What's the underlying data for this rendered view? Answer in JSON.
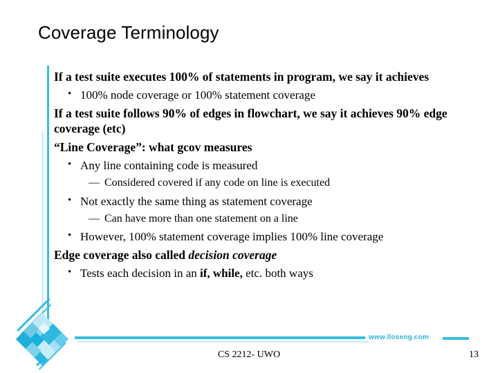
{
  "slide": {
    "title": "Coverage Terminology",
    "body": [
      {
        "level": 1,
        "text": "If a test suite executes 100% of statements in program, we say it achieves"
      },
      {
        "level": 2,
        "bullet": "•",
        "text": "100% node coverage or 100% statement coverage"
      },
      {
        "level": 1,
        "text": "If a test suite follows 90% of edges in flowchart, we say it achieves 90% edge coverage (etc)"
      },
      {
        "level": 1,
        "text": "“Line Coverage”: what gcov measures"
      },
      {
        "level": 2,
        "bullet": "•",
        "text": "Any line containing code is measured"
      },
      {
        "level": 3,
        "bullet": "—",
        "text": "Considered covered if any code on line is executed"
      },
      {
        "level": 2,
        "bullet": "•",
        "text": "Not exactly the same thing as statement coverage"
      },
      {
        "level": 3,
        "bullet": "—",
        "text": "Can have more than one statement on a line"
      },
      {
        "level": 2,
        "bullet": "•",
        "text": "However, 100% statement coverage implies 100% line coverage"
      },
      {
        "level": 1,
        "text_plain": "Edge coverage also called ",
        "text_emphasis": "decision coverage"
      },
      {
        "level": 2,
        "bullet": "•",
        "text_pre": "Tests each decision in an ",
        "text_bold": "if, while,",
        "text_post": " etc. both ways"
      }
    ]
  },
  "footer": {
    "url": "www.lloseng.com",
    "course": "CS 2212- UWO",
    "page_number": "13"
  },
  "colors": {
    "accent_cyan": "#35BEDD",
    "accent_light": "#CDEDF8",
    "url_text": "#2FB5D8",
    "body_text": "#000000"
  }
}
